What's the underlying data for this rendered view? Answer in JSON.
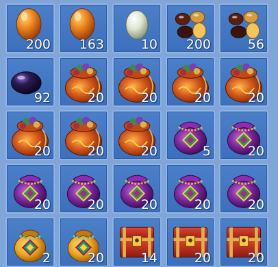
{
  "inventory": {
    "slots": [
      {
        "item_icon": "orange-egg-icon",
        "count": "200"
      },
      {
        "item_icon": "orange-egg-icon",
        "count": "163"
      },
      {
        "item_icon": "white-egg-icon",
        "count": "10"
      },
      {
        "item_icon": "gem-pile-icon",
        "count": "200"
      },
      {
        "item_icon": "gem-pile-icon",
        "count": "56"
      },
      {
        "item_icon": "dark-purple-egg-icon",
        "count": "92"
      },
      {
        "item_icon": "orange-treasure-bag-icon",
        "count": "20"
      },
      {
        "item_icon": "orange-treasure-bag-icon",
        "count": "20"
      },
      {
        "item_icon": "orange-treasure-bag-icon",
        "count": "20"
      },
      {
        "item_icon": "orange-treasure-bag-icon",
        "count": "20"
      },
      {
        "item_icon": "orange-treasure-bag-icon",
        "count": "20"
      },
      {
        "item_icon": "orange-treasure-bag-icon",
        "count": "20"
      },
      {
        "item_icon": "orange-treasure-bag-icon",
        "count": "20"
      },
      {
        "item_icon": "purple-pouch-icon",
        "count": "5"
      },
      {
        "item_icon": "purple-pouch-icon",
        "count": "20"
      },
      {
        "item_icon": "purple-pouch-icon",
        "count": "20"
      },
      {
        "item_icon": "purple-pouch-icon",
        "count": "20"
      },
      {
        "item_icon": "purple-pouch-icon",
        "count": "20"
      },
      {
        "item_icon": "purple-pouch-icon",
        "count": "20"
      },
      {
        "item_icon": "purple-pouch-icon",
        "count": "20"
      },
      {
        "item_icon": "gold-pouch-icon",
        "count": "2"
      },
      {
        "item_icon": "gold-pouch-icon",
        "count": "20"
      },
      {
        "item_icon": "red-treasure-chest-icon",
        "count": "14"
      },
      {
        "item_icon": "red-treasure-chest-icon",
        "count": "20"
      },
      {
        "item_icon": "red-treasure-chest-icon",
        "count": "20"
      }
    ]
  },
  "colors": {
    "background": "#7fa6d6",
    "slot": "#4378c4",
    "slot_border": "#8fb4e8",
    "count_text": "#ffffff"
  }
}
